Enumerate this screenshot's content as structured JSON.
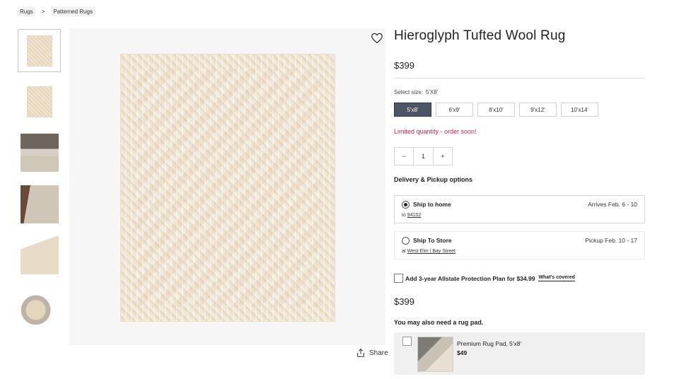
{
  "breadcrumb": {
    "items": [
      "Rugs",
      "Patterned Rugs"
    ],
    "separator": ">"
  },
  "gallery": {
    "thumbnails": [
      "rug-front",
      "rug-front-small",
      "living-room",
      "room-corner",
      "rug-corner-detail",
      "rug-rolled",
      "rug-partial"
    ],
    "active_index": 0,
    "scroll_icon": "chevron-down-icon",
    "favorite_icon": "heart-icon",
    "share_label": "Share"
  },
  "product": {
    "title": "Hieroglyph Tufted Wool Rug",
    "price": "$399",
    "size_label": "Select size:",
    "selected_size": "5'X8'",
    "sizes": [
      "5'x8'",
      "6'x9'",
      "8'x10'",
      "9'x12'",
      "10'x14'"
    ],
    "stock_message": "Limited quantity - order soon!",
    "quantity": {
      "minus": "−",
      "value": "1",
      "plus": "+"
    },
    "delivery_heading": "Delivery & Pickup options",
    "delivery_options": [
      {
        "title": "Ship to home",
        "right": "Arrives Feb. 6 - 10",
        "sub_prefix": "to",
        "sub_link": "94102",
        "selected": true
      },
      {
        "title": "Ship To Store",
        "right": "Pickup Feb. 10 - 17",
        "sub_prefix": "at",
        "sub_link": "West Elm | Bay Street",
        "selected": false
      }
    ],
    "protection": {
      "label": "Add 3-year Allstate Protection Plan for $34.99",
      "link": "What's covered"
    },
    "total_price": "$399",
    "rug_pad_heading": "You may also need a rug pad.",
    "rug_pad": {
      "name": "Premium Rug Pad, 5'x8'",
      "price": "$49"
    }
  },
  "colors": {
    "selected_size_bg": "#4c5566",
    "limited_text": "#a8324a",
    "pad_bg": "#f0f0f0"
  }
}
